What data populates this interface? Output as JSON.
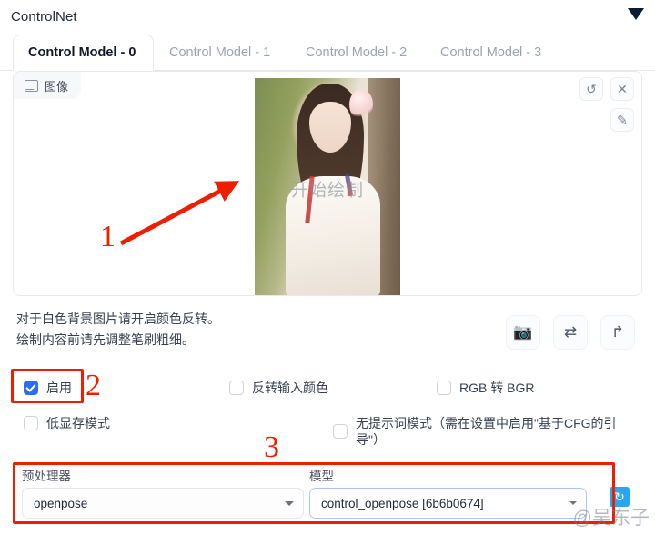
{
  "panel": {
    "title": "ControlNet",
    "collapse_icon": "triangle-down-icon"
  },
  "tabs": [
    {
      "label": "Control Model - 0",
      "active": true
    },
    {
      "label": "Control Model - 1",
      "active": false
    },
    {
      "label": "Control Model - 2",
      "active": false
    },
    {
      "label": "Control Model - 3",
      "active": false
    }
  ],
  "image_area": {
    "tab_label": "图像",
    "tab_icon": "picture-icon",
    "overlay_text": "开始绘制",
    "tools": {
      "undo": "undo-icon",
      "close": "close-icon",
      "edit": "pen-edit-icon"
    }
  },
  "hint": {
    "line1": "对于白色背景图片请开启颜色反转。",
    "line2": "绘制内容前请先调整笔刷粗细。"
  },
  "actions": [
    {
      "icon": "camera-icon",
      "glyph": "📷"
    },
    {
      "icon": "swap-arrows-icon",
      "glyph": "⇄"
    },
    {
      "icon": "send-to-icon",
      "glyph": "↱"
    }
  ],
  "checkboxes": {
    "enable": {
      "label": "启用",
      "checked": true
    },
    "invert_input_color": {
      "label": "反转输入颜色",
      "checked": false
    },
    "rgb_to_bgr": {
      "label": "RGB 转 BGR",
      "checked": false
    },
    "low_vram": {
      "label": "低显存模式",
      "checked": false
    },
    "guess_mode": {
      "label": "无提示词模式（需在设置中启用\"基于CFG的引导\"）",
      "checked": false
    }
  },
  "fields": {
    "preprocessor": {
      "label": "预处理器",
      "value": "openpose",
      "focused": false
    },
    "model": {
      "label": "模型",
      "value": "control_openpose [6b6b0674]",
      "focused": true
    },
    "refresh_icon": "refresh-icon"
  },
  "annotations": {
    "one": "1",
    "two": "2",
    "three": "3",
    "accent_color": "#f01e00"
  },
  "watermark": "@吴东子"
}
